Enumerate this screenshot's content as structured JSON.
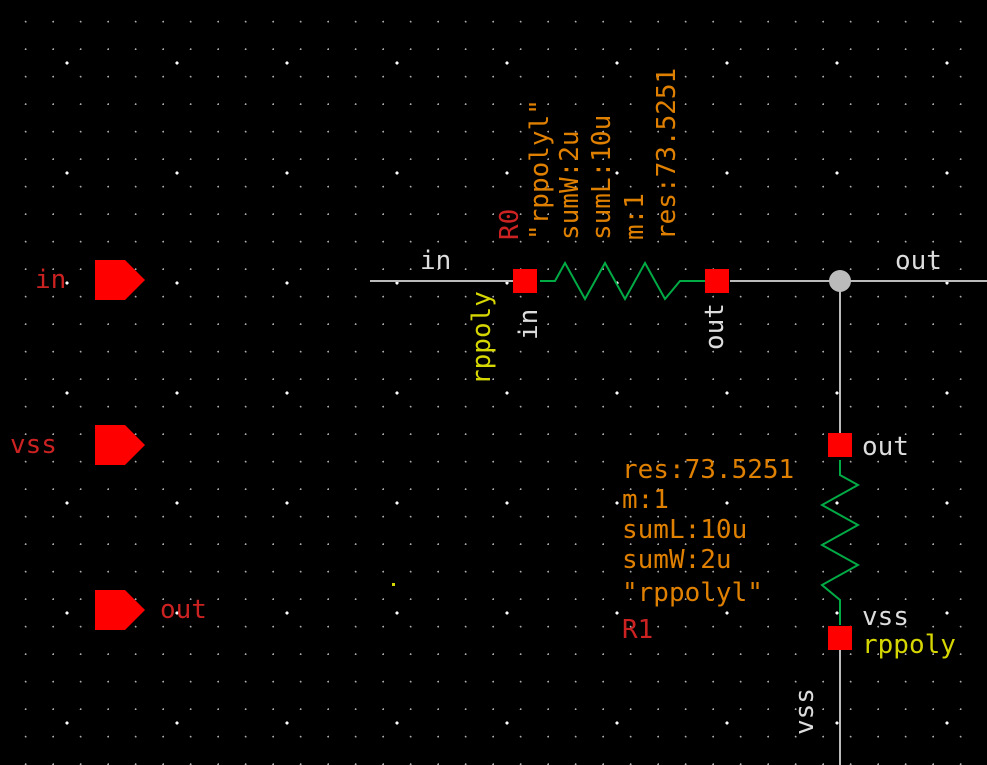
{
  "ports": {
    "in": {
      "label": "in"
    },
    "vss": {
      "label": "vss"
    },
    "out": {
      "label": "out"
    }
  },
  "nets": {
    "in_top": "in",
    "out_top": "out",
    "r0_in": "in",
    "r0_out": "out",
    "r1_out": "out",
    "r1_vss": "vss",
    "vss_v": "vss"
  },
  "r0": {
    "name": "R0",
    "cell": "rppoly",
    "model": "\"rppolyl\"",
    "sumW": "sumW:2u",
    "sumL": "sumL:10u",
    "m": "m:1",
    "res": "res:73.5251"
  },
  "r1": {
    "name": "R1",
    "cell": "rppoly",
    "model": "\"rppolyl\"",
    "sumW": "sumW:2u",
    "sumL": "sumL:10u",
    "m": "m:1",
    "res": "res:73.5251"
  }
}
